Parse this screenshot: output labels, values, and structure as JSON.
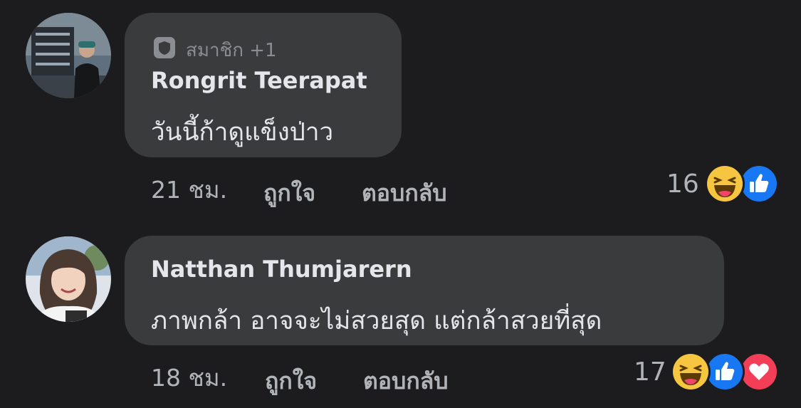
{
  "comments": [
    {
      "badge": {
        "icon": "shield-icon",
        "label": "สมาชิก +1"
      },
      "author": "Rongrit Teerapat",
      "text": "วันนี้ก้าดูแข็งป่าว",
      "time": "21 ชม.",
      "like_label": "ถูกใจ",
      "reply_label": "ตอบกลับ",
      "reaction_count": "16",
      "reactions": [
        "haha-reaction-icon",
        "like-reaction-icon"
      ]
    },
    {
      "author": "Natthan Thumjarern",
      "text": "ภาพกล้า อาจจะไม่สวยสุด แต่กล้าสวยที่สุด",
      "time": "18 ชม.",
      "like_label": "ถูกใจ",
      "reply_label": "ตอบกลับ",
      "reaction_count": "17",
      "reactions": [
        "haha-reaction-icon",
        "like-reaction-icon",
        "love-reaction-icon"
      ]
    }
  ],
  "colors": {
    "background": "#1c1c1e",
    "bubble": "#3a3b3c",
    "like_blue": "#1877f2",
    "love_red": "#f33e58",
    "haha_yellow": "#f7c641"
  }
}
